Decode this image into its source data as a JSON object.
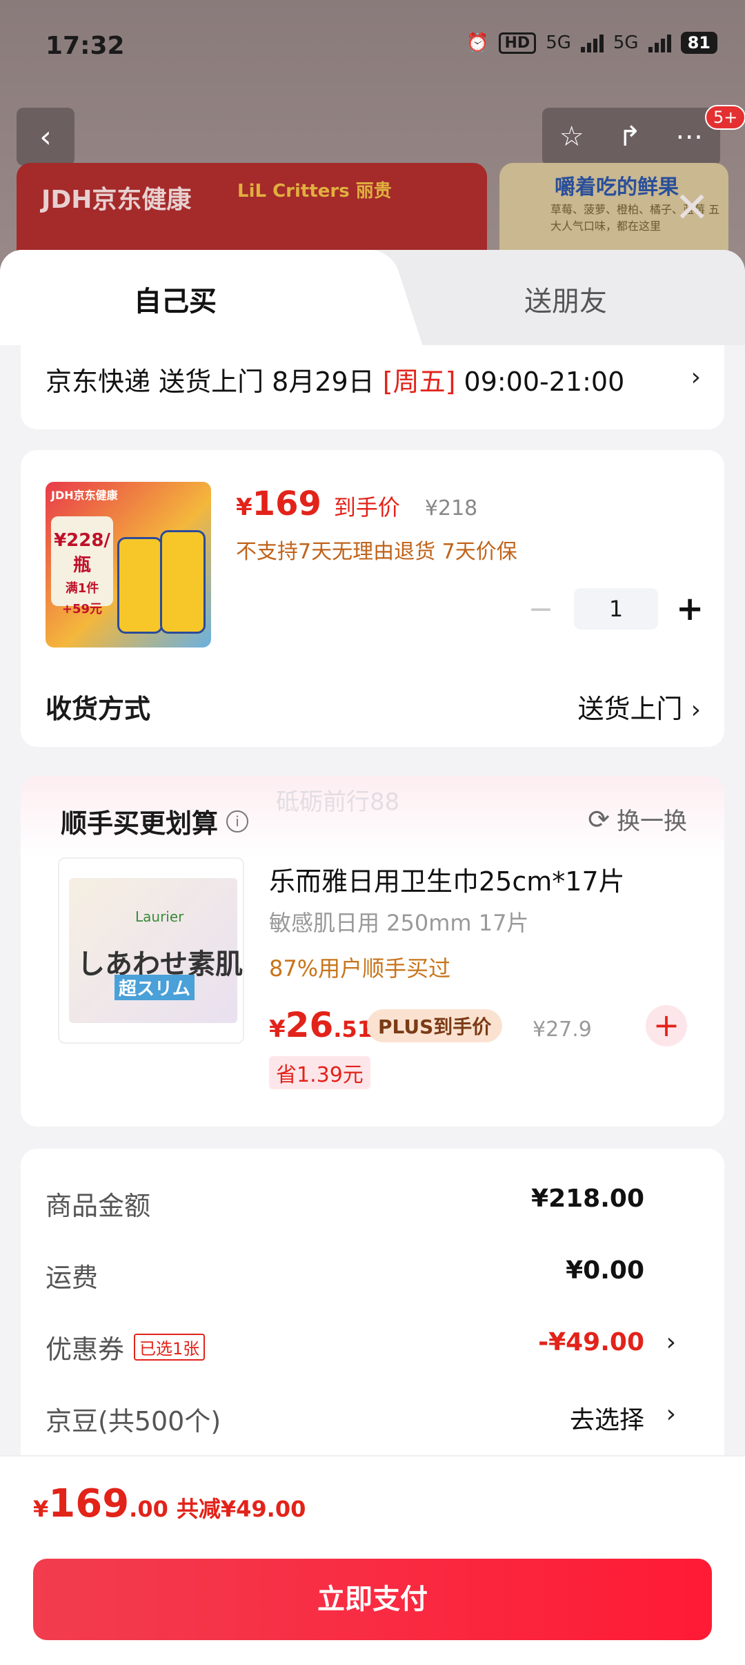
{
  "status_bar": {
    "time": "17:32",
    "hd": "HD",
    "net1": "5G",
    "net2": "5G",
    "battery": "81"
  },
  "background": {
    "brand": "JDH京东健康",
    "sub_brand": "LiL Critters 丽贵",
    "promo_title": "嚼着吃的鲜果",
    "promo_sub": "草莓、菠萝、橙柏、橘子、蓝莓 五大人气口味，都在这里",
    "notif_badge": "5+"
  },
  "tabs": {
    "self": "自己买",
    "gift": "送朋友"
  },
  "delivery": {
    "prefix": "京东快递 送货上门 8月29日 ",
    "weekday": "[周五]",
    "time": " 09:00-21:00"
  },
  "product": {
    "image_text": {
      "brand": "JDH京东健康",
      "price": "¥228/瓶",
      "extra": "满1件 +59元"
    },
    "price_symbol": "¥",
    "price": "169",
    "price_label": "到手价",
    "original_price": "¥218",
    "note": "不支持7天无理由退货 7天价保",
    "quantity": "1",
    "shipping_label": "收货方式",
    "shipping_value": "送货上门"
  },
  "addon": {
    "heading": "顺手买更划算",
    "watermark": "砥砺前行88",
    "swap_label": "换一换",
    "image_text": {
      "brand": "Laurier",
      "jp": "しあわせ素肌",
      "sub": "超スリム"
    },
    "title": "乐而雅日用卫生巾25cm*17片",
    "spec": "敏感肌日用 250mm 17片",
    "bought": "87%用户顺手买过",
    "price_symbol": "¥",
    "price_int": "26",
    "price_dec": ".51",
    "plus_label": "PLUS到手价",
    "original_price": "¥27.9",
    "save": "省1.39元"
  },
  "summary": {
    "goods_label": "商品金额",
    "goods_value": "¥218.00",
    "freight_label": "运费",
    "freight_value": "¥0.00",
    "coupon_label": "优惠券",
    "coupon_selected": "已选1张",
    "coupon_value": "-¥49.00",
    "beans_label": "京豆(共500个)",
    "beans_value": "去选择"
  },
  "bottom": {
    "symbol": "¥",
    "total_int": "169",
    "total_dec": ".00",
    "reduced": "共减¥49.00",
    "pay_label": "立即支付"
  },
  "colors": {
    "accent": "#e2231a",
    "pay_start": "#f23d4f",
    "pay_end": "#ff1a35"
  }
}
